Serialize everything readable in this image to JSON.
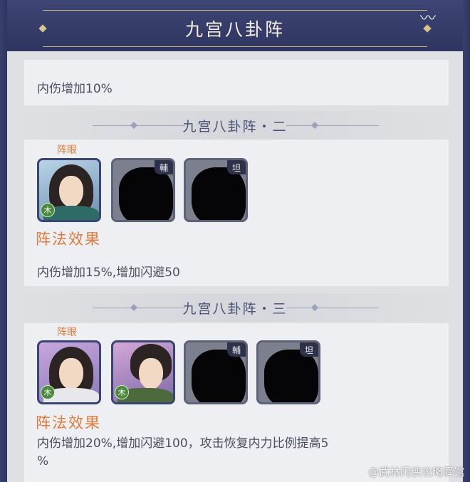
{
  "header": {
    "title": "九宫八卦阵"
  },
  "sections": [
    {
      "effect": "内伤增加10%"
    },
    {
      "title": "九宫八卦阵・二",
      "eye_label": "阵眼",
      "slots": [
        {
          "type": "hero",
          "element": "木"
        },
        {
          "type": "empty",
          "tag": "輔"
        },
        {
          "type": "empty",
          "tag": "坦"
        }
      ],
      "effect_title": "阵法效果",
      "effect": "内伤增加15%,增加闪避50"
    },
    {
      "title": "九宫八卦阵・三",
      "eye_label": "阵眼",
      "slots": [
        {
          "type": "hero",
          "element": "木"
        },
        {
          "type": "hero",
          "element": "木"
        },
        {
          "type": "empty",
          "tag": "輔"
        },
        {
          "type": "empty",
          "tag": "坦"
        }
      ],
      "effect_title": "阵法效果",
      "effect_line1": "内伤增加20%,增加闪避100，攻击恢复内力比例提高5",
      "effect_line2": "%"
    }
  ],
  "watermark": "@武林闲侠攻略驿馆"
}
